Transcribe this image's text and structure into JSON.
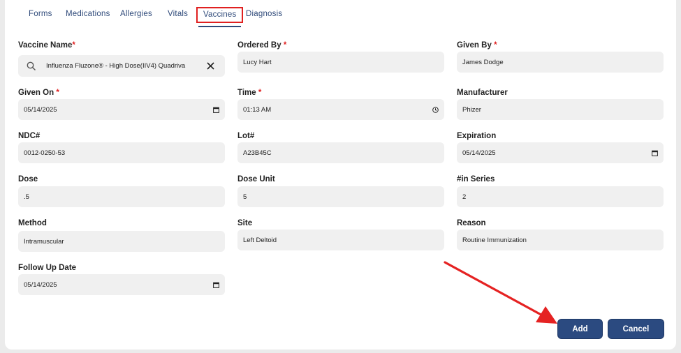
{
  "tabs": {
    "forms": "Forms",
    "medications": "Medications",
    "allergies": "Allergies",
    "vitals": "Vitals",
    "vaccines": "Vaccines",
    "diagnosis": "Diagnosis",
    "active": "Vaccines"
  },
  "form": {
    "vaccine_name": {
      "label": "Vaccine Name",
      "required": "*",
      "value": "Influenza Fluzone® - High Dose(IIV4) Quadriva"
    },
    "ordered_by": {
      "label": "Ordered By",
      "required": "*",
      "value": "Lucy Hart"
    },
    "given_by": {
      "label": "Given By",
      "required": "*",
      "value": "James Dodge"
    },
    "given_on": {
      "label": "Given On",
      "required": "*",
      "value": "05/14/2025"
    },
    "time": {
      "label": "Time",
      "required": "*",
      "value": "01:13 AM"
    },
    "manufacturer": {
      "label": "Manufacturer",
      "value": "Phizer"
    },
    "ndc": {
      "label": "NDC#",
      "value": "0012-0250-53"
    },
    "lot": {
      "label": "Lot#",
      "value": "A23B45C"
    },
    "expiration": {
      "label": "Expiration",
      "value": "05/14/2025"
    },
    "dose": {
      "label": "Dose",
      "value": ".5"
    },
    "dose_unit": {
      "label": "Dose Unit",
      "value": "5"
    },
    "in_series": {
      "label": "#in Series",
      "value": "2"
    },
    "method": {
      "label": "Method",
      "value": "Intramuscular"
    },
    "site": {
      "label": "Site",
      "value": "Left Deltoid"
    },
    "reason": {
      "label": "Reason",
      "value": "Routine Immunization"
    },
    "follow_up_date": {
      "label": "Follow Up Date",
      "value": "05/14/2025"
    }
  },
  "buttons": {
    "add": "Add",
    "cancel": "Cancel"
  },
  "colors": {
    "primary": "#2b4a80",
    "required": "#e02020",
    "field_bg": "#f0f0f0",
    "annotation": "#e02020"
  }
}
